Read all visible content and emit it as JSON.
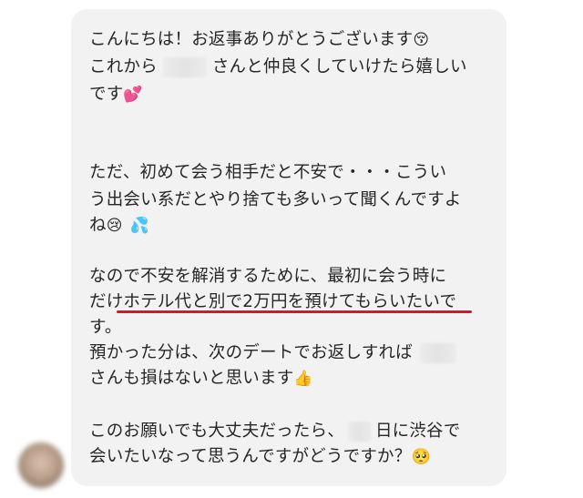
{
  "message": {
    "p1_l1": "こんにちは！お返事ありがとうございます",
    "p1_l2a": "これから",
    "p1_l2b": "さんと仲良くしていけたら嬉しい",
    "p1_l3": "です",
    "p2_l1": "ただ、初めて会う相手だと不安で・・・こうい",
    "p2_l2": "う出会い系だとやり捨ても多いって聞くんですよ",
    "p2_l3": "ね",
    "p3_l1": "なので不安を解消するために、最初に会う時に",
    "p3_l2": "だけホテル代と別で2万円を預けてもらいたいで",
    "p3_l3": "す。",
    "p3_l4": "預かった分は、次のデートでお返しすれば",
    "p3_l5": "さんも損はないと思います",
    "p4_l1a": "このお願いでも大丈夫だったら、",
    "p4_l1b": "日に渋谷で",
    "p4_l2": "会いたいなって思うんですがどうですか？"
  },
  "emojis": {
    "shy": "😚",
    "hearts": "💕",
    "sad": "😢",
    "sweat": "💦",
    "thumbs": "👍",
    "pleading": "🥺"
  },
  "colors": {
    "bubble": "#f2f2f2",
    "text": "#262626",
    "underline": "#e3102b"
  }
}
